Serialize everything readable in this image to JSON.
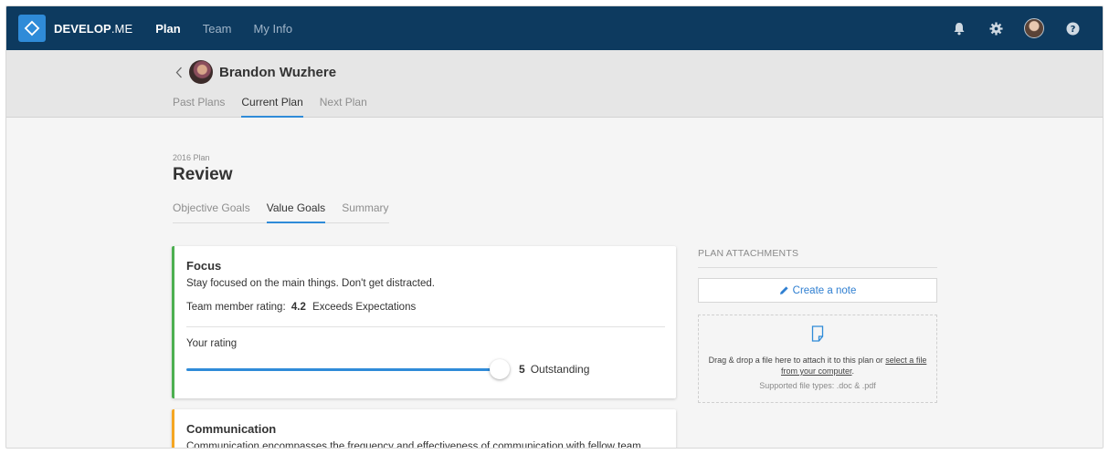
{
  "app": {
    "brand_bold": "DEVELOP",
    "brand_light": ".ME",
    "nav": [
      {
        "label": "Plan",
        "active": true
      },
      {
        "label": "Team",
        "active": false
      },
      {
        "label": "My Info",
        "active": false
      }
    ],
    "icons": [
      "bell-icon",
      "gear-icon",
      "user-avatar",
      "help-icon"
    ]
  },
  "person": {
    "name": "Brandon Wuzhere"
  },
  "plan_tabs": [
    {
      "label": "Past Plans",
      "active": false
    },
    {
      "label": "Current Plan",
      "active": true
    },
    {
      "label": "Next Plan",
      "active": false
    }
  ],
  "page": {
    "year_label": "2016 Plan",
    "title": "Review"
  },
  "goal_tabs": [
    {
      "label": "Objective Goals",
      "active": false
    },
    {
      "label": "Value Goals",
      "active": true
    },
    {
      "label": "Summary",
      "active": false
    }
  ],
  "goals": [
    {
      "title": "Focus",
      "description": "Stay focused on the main things. Don't get distracted.",
      "team_member_rating_label": "Team member rating:",
      "team_member_rating_value": "4.2",
      "team_member_rating_text": "Exceeds Expectations",
      "your_rating_label": "Your rating",
      "your_rating_value": "5",
      "your_rating_text": "Outstanding",
      "your_rating_fraction": 1.0,
      "accent_color": "#4caf50"
    },
    {
      "title": "Communication",
      "description": "Communication encompasses the frequency and effectiveness of communication with fellow team",
      "accent_color": "#f5a623"
    }
  ],
  "attachments": {
    "title": "PLAN ATTACHMENTS",
    "create_note_label": "Create a note",
    "drop_text": "Drag & drop a file here to attach it to this plan or",
    "drop_link_text": "select a file from your computer",
    "drop_suffix": ".",
    "supported_types": "Supported file types: .doc & .pdf"
  },
  "colors": {
    "topbar": "#0d3a5f",
    "accent": "#2f8bd8",
    "link": "#2f7fd1"
  }
}
